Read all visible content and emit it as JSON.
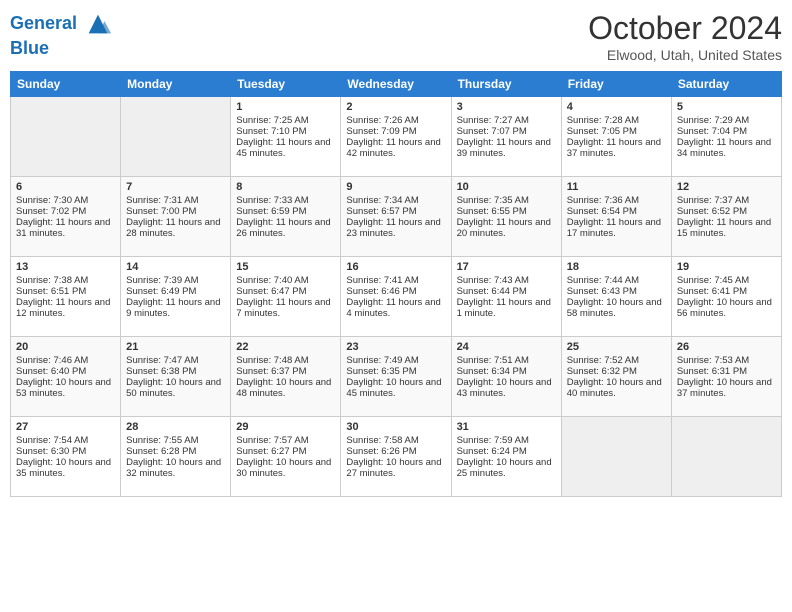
{
  "header": {
    "logo_line1": "General",
    "logo_line2": "Blue",
    "month": "October 2024",
    "location": "Elwood, Utah, United States"
  },
  "days_of_week": [
    "Sunday",
    "Monday",
    "Tuesday",
    "Wednesday",
    "Thursday",
    "Friday",
    "Saturday"
  ],
  "weeks": [
    [
      {
        "day": "",
        "empty": true
      },
      {
        "day": "",
        "empty": true
      },
      {
        "day": "1",
        "sunrise": "Sunrise: 7:25 AM",
        "sunset": "Sunset: 7:10 PM",
        "daylight": "Daylight: 11 hours and 45 minutes."
      },
      {
        "day": "2",
        "sunrise": "Sunrise: 7:26 AM",
        "sunset": "Sunset: 7:09 PM",
        "daylight": "Daylight: 11 hours and 42 minutes."
      },
      {
        "day": "3",
        "sunrise": "Sunrise: 7:27 AM",
        "sunset": "Sunset: 7:07 PM",
        "daylight": "Daylight: 11 hours and 39 minutes."
      },
      {
        "day": "4",
        "sunrise": "Sunrise: 7:28 AM",
        "sunset": "Sunset: 7:05 PM",
        "daylight": "Daylight: 11 hours and 37 minutes."
      },
      {
        "day": "5",
        "sunrise": "Sunrise: 7:29 AM",
        "sunset": "Sunset: 7:04 PM",
        "daylight": "Daylight: 11 hours and 34 minutes."
      }
    ],
    [
      {
        "day": "6",
        "sunrise": "Sunrise: 7:30 AM",
        "sunset": "Sunset: 7:02 PM",
        "daylight": "Daylight: 11 hours and 31 minutes."
      },
      {
        "day": "7",
        "sunrise": "Sunrise: 7:31 AM",
        "sunset": "Sunset: 7:00 PM",
        "daylight": "Daylight: 11 hours and 28 minutes."
      },
      {
        "day": "8",
        "sunrise": "Sunrise: 7:33 AM",
        "sunset": "Sunset: 6:59 PM",
        "daylight": "Daylight: 11 hours and 26 minutes."
      },
      {
        "day": "9",
        "sunrise": "Sunrise: 7:34 AM",
        "sunset": "Sunset: 6:57 PM",
        "daylight": "Daylight: 11 hours and 23 minutes."
      },
      {
        "day": "10",
        "sunrise": "Sunrise: 7:35 AM",
        "sunset": "Sunset: 6:55 PM",
        "daylight": "Daylight: 11 hours and 20 minutes."
      },
      {
        "day": "11",
        "sunrise": "Sunrise: 7:36 AM",
        "sunset": "Sunset: 6:54 PM",
        "daylight": "Daylight: 11 hours and 17 minutes."
      },
      {
        "day": "12",
        "sunrise": "Sunrise: 7:37 AM",
        "sunset": "Sunset: 6:52 PM",
        "daylight": "Daylight: 11 hours and 15 minutes."
      }
    ],
    [
      {
        "day": "13",
        "sunrise": "Sunrise: 7:38 AM",
        "sunset": "Sunset: 6:51 PM",
        "daylight": "Daylight: 11 hours and 12 minutes."
      },
      {
        "day": "14",
        "sunrise": "Sunrise: 7:39 AM",
        "sunset": "Sunset: 6:49 PM",
        "daylight": "Daylight: 11 hours and 9 minutes."
      },
      {
        "day": "15",
        "sunrise": "Sunrise: 7:40 AM",
        "sunset": "Sunset: 6:47 PM",
        "daylight": "Daylight: 11 hours and 7 minutes."
      },
      {
        "day": "16",
        "sunrise": "Sunrise: 7:41 AM",
        "sunset": "Sunset: 6:46 PM",
        "daylight": "Daylight: 11 hours and 4 minutes."
      },
      {
        "day": "17",
        "sunrise": "Sunrise: 7:43 AM",
        "sunset": "Sunset: 6:44 PM",
        "daylight": "Daylight: 11 hours and 1 minute."
      },
      {
        "day": "18",
        "sunrise": "Sunrise: 7:44 AM",
        "sunset": "Sunset: 6:43 PM",
        "daylight": "Daylight: 10 hours and 58 minutes."
      },
      {
        "day": "19",
        "sunrise": "Sunrise: 7:45 AM",
        "sunset": "Sunset: 6:41 PM",
        "daylight": "Daylight: 10 hours and 56 minutes."
      }
    ],
    [
      {
        "day": "20",
        "sunrise": "Sunrise: 7:46 AM",
        "sunset": "Sunset: 6:40 PM",
        "daylight": "Daylight: 10 hours and 53 minutes."
      },
      {
        "day": "21",
        "sunrise": "Sunrise: 7:47 AM",
        "sunset": "Sunset: 6:38 PM",
        "daylight": "Daylight: 10 hours and 50 minutes."
      },
      {
        "day": "22",
        "sunrise": "Sunrise: 7:48 AM",
        "sunset": "Sunset: 6:37 PM",
        "daylight": "Daylight: 10 hours and 48 minutes."
      },
      {
        "day": "23",
        "sunrise": "Sunrise: 7:49 AM",
        "sunset": "Sunset: 6:35 PM",
        "daylight": "Daylight: 10 hours and 45 minutes."
      },
      {
        "day": "24",
        "sunrise": "Sunrise: 7:51 AM",
        "sunset": "Sunset: 6:34 PM",
        "daylight": "Daylight: 10 hours and 43 minutes."
      },
      {
        "day": "25",
        "sunrise": "Sunrise: 7:52 AM",
        "sunset": "Sunset: 6:32 PM",
        "daylight": "Daylight: 10 hours and 40 minutes."
      },
      {
        "day": "26",
        "sunrise": "Sunrise: 7:53 AM",
        "sunset": "Sunset: 6:31 PM",
        "daylight": "Daylight: 10 hours and 37 minutes."
      }
    ],
    [
      {
        "day": "27",
        "sunrise": "Sunrise: 7:54 AM",
        "sunset": "Sunset: 6:30 PM",
        "daylight": "Daylight: 10 hours and 35 minutes."
      },
      {
        "day": "28",
        "sunrise": "Sunrise: 7:55 AM",
        "sunset": "Sunset: 6:28 PM",
        "daylight": "Daylight: 10 hours and 32 minutes."
      },
      {
        "day": "29",
        "sunrise": "Sunrise: 7:57 AM",
        "sunset": "Sunset: 6:27 PM",
        "daylight": "Daylight: 10 hours and 30 minutes."
      },
      {
        "day": "30",
        "sunrise": "Sunrise: 7:58 AM",
        "sunset": "Sunset: 6:26 PM",
        "daylight": "Daylight: 10 hours and 27 minutes."
      },
      {
        "day": "31",
        "sunrise": "Sunrise: 7:59 AM",
        "sunset": "Sunset: 6:24 PM",
        "daylight": "Daylight: 10 hours and 25 minutes."
      },
      {
        "day": "",
        "empty": true
      },
      {
        "day": "",
        "empty": true
      }
    ]
  ]
}
